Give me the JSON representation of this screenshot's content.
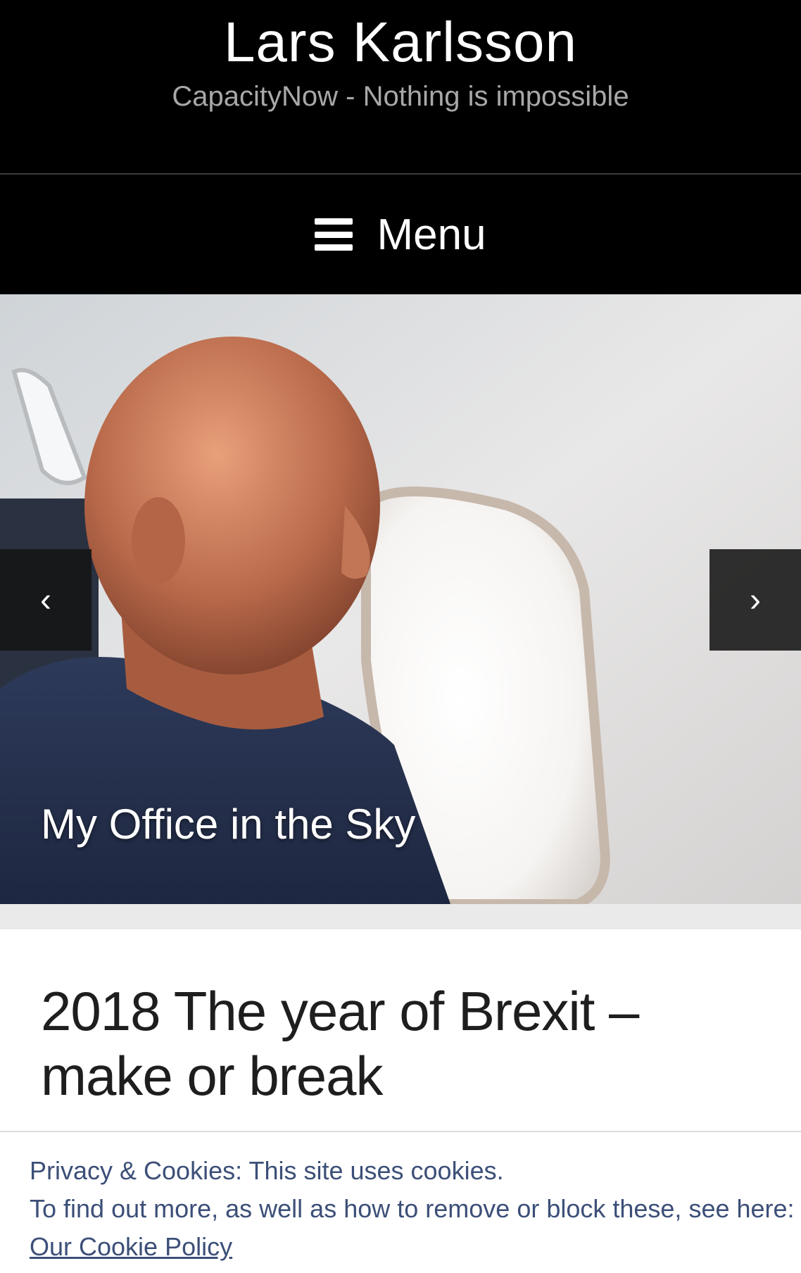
{
  "header": {
    "site_title": "Lars Karlsson",
    "tagline": "CapacityNow - Nothing is impossible"
  },
  "menu": {
    "label": "Menu",
    "icon": "hamburger-icon"
  },
  "slider": {
    "caption": "My Office in the Sky",
    "prev_icon": "chevron-left-icon",
    "next_icon": "chevron-right-icon",
    "prev_glyph": "‹",
    "next_glyph": "›"
  },
  "post": {
    "title": "2018 The year of Brexit – make or break"
  },
  "cookie_banner": {
    "line1": "Privacy & Cookies: This site uses cookies.",
    "line2": "To find out more, as well as how to remove or block these, see here:",
    "link": "Our Cookie Policy"
  },
  "colors": {
    "header_bg": "#000000",
    "tagline": "#a8a8a8",
    "cookie_text": "#3c4f78"
  }
}
